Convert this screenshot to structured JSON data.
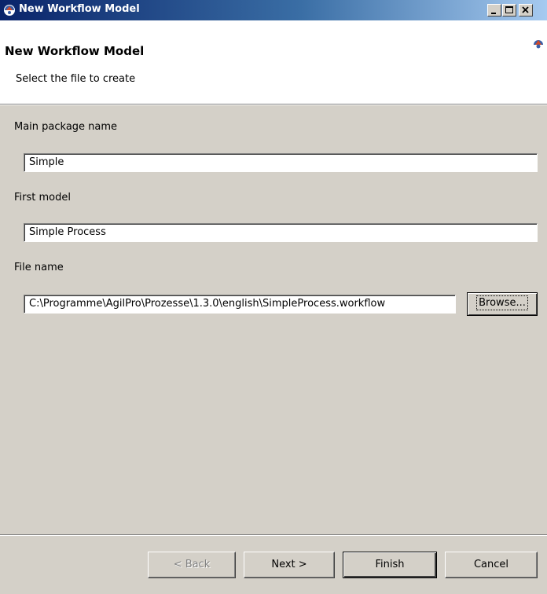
{
  "window": {
    "title": "New Workflow Model",
    "controls": {
      "minimize_icon": "minimize-icon",
      "maximize_icon": "maximize-icon",
      "close_icon": "close-icon"
    }
  },
  "header": {
    "title": "New Workflow Model",
    "description": "Select the file to create",
    "icon": "app-logo-icon"
  },
  "form": {
    "package_label": "Main package name",
    "package_value": "Simple",
    "model_label": "First model",
    "model_value": "Simple Process",
    "file_label": "File name",
    "file_value": "C:\\Programme\\AgilPro\\Prozesse\\1.3.0\\english\\SimpleProcess.workflow",
    "browse_label": "Browse..."
  },
  "footer": {
    "back_label": "< Back",
    "next_label": "Next >",
    "finish_label": "Finish",
    "cancel_label": "Cancel"
  }
}
